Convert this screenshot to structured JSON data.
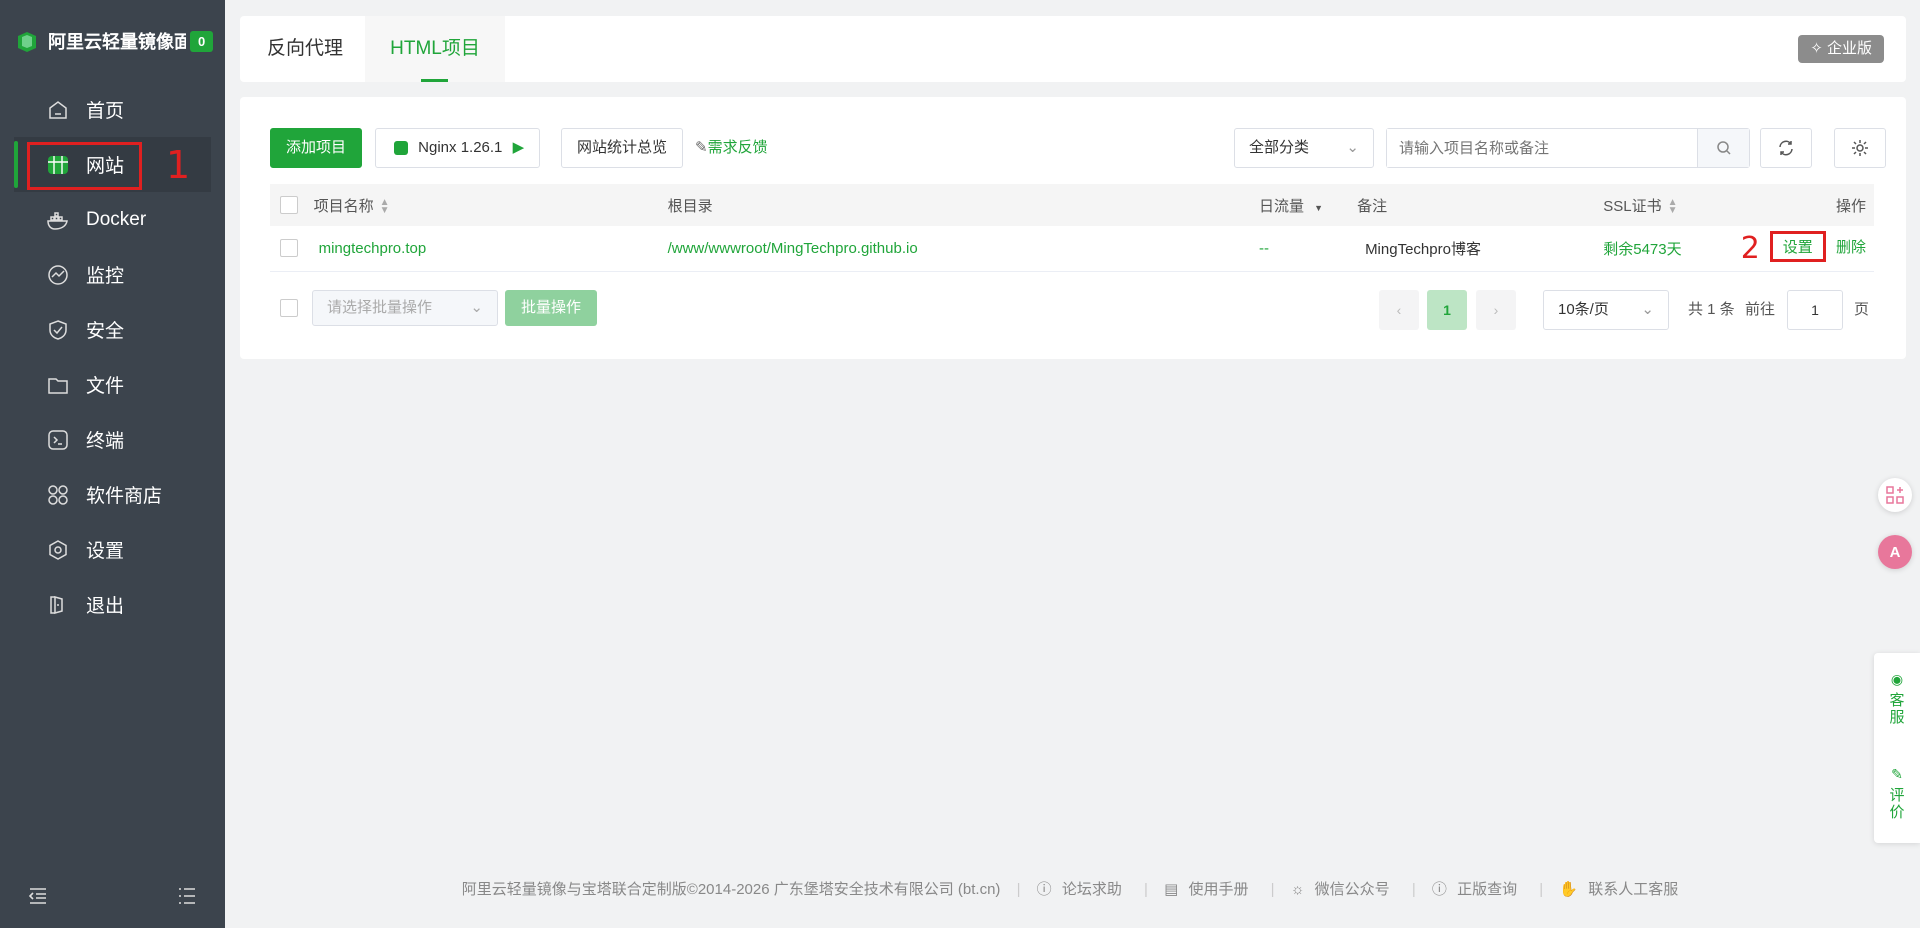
{
  "sidebar": {
    "brand_name": "阿里云轻量镜像面板",
    "badge": "0",
    "items": [
      {
        "label": "首页",
        "icon": "home-icon"
      },
      {
        "label": "网站",
        "icon": "website-icon"
      },
      {
        "label": "Docker",
        "icon": "docker-icon"
      },
      {
        "label": "监控",
        "icon": "monitor-icon"
      },
      {
        "label": "安全",
        "icon": "shield-icon"
      },
      {
        "label": "文件",
        "icon": "folder-icon"
      },
      {
        "label": "终端",
        "icon": "terminal-icon"
      },
      {
        "label": "软件商店",
        "icon": "apps-icon"
      },
      {
        "label": "设置",
        "icon": "gear-icon"
      },
      {
        "label": "退出",
        "icon": "logout-icon"
      }
    ],
    "annotation_1": "1"
  },
  "tabs": {
    "reverse_proxy": "反向代理",
    "html_project": "HTML项目"
  },
  "enterprise_button": "企业版",
  "toolbar": {
    "add_project": "添加项目",
    "nginx": "Nginx 1.26.1",
    "stats": "网站统计总览",
    "feedback": "需求反馈",
    "category": "全部分类",
    "search_placeholder": "请输入项目名称或备注"
  },
  "table": {
    "headers": {
      "name": "项目名称",
      "root": "根目录",
      "traffic": "日流量",
      "remark": "备注",
      "ssl": "SSL证书",
      "actions": "操作"
    },
    "rows": [
      {
        "name": "mingtechpro.top",
        "root": "/www/wwwroot/MingTechpro.github.io",
        "traffic": "--",
        "remark": "MingTechpro博客",
        "ssl": "剩余5473天",
        "settings": "设置",
        "delete": "删除"
      }
    ],
    "annotation_2": "2"
  },
  "batch": {
    "select_placeholder": "请选择批量操作",
    "button": "批量操作"
  },
  "pagination": {
    "current_page": "1",
    "page_size": "10条/页",
    "total": "共 1 条",
    "goto_label": "前往",
    "goto_value": "1",
    "page_unit": "页"
  },
  "footer": {
    "copyright": "阿里云轻量镜像与宝塔联合定制版©2014-2026 广东堡塔安全技术有限公司 (bt.cn)",
    "links": [
      "论坛求助",
      "使用手册",
      "微信公众号",
      "正版查询",
      "联系人工客服"
    ]
  },
  "float": {
    "service": "客服",
    "review": "评价"
  },
  "colors": {
    "accent": "#20a53a",
    "sidebar": "#3c444d",
    "annotation": "#e02020"
  }
}
